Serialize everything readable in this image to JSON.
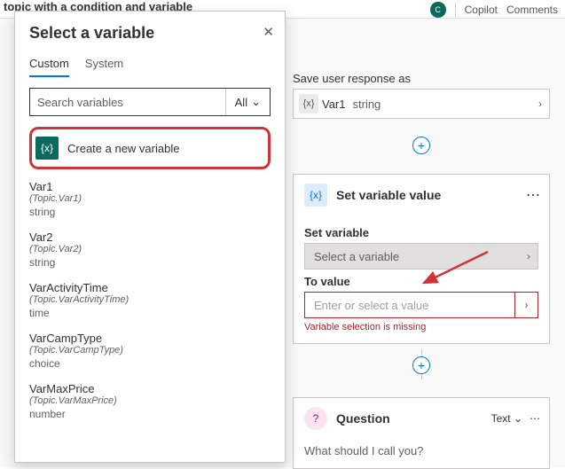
{
  "topbar": {
    "title_fragment": "topic with a condition and variable",
    "copilot": "Copilot",
    "comments": "Comments"
  },
  "flow": {
    "save_label": "Save user response as",
    "saved_var": {
      "name": "Var1",
      "type": "string"
    },
    "set_node": {
      "title": "Set variable value",
      "set_label": "Set variable",
      "select_placeholder": "Select a variable",
      "to_label": "To value",
      "to_placeholder": "Enter or select a value",
      "error": "Variable selection is missing"
    },
    "question_node": {
      "title": "Question",
      "type_label": "Text",
      "prompt": "What should I call you?"
    }
  },
  "popover": {
    "title": "Select a variable",
    "tabs": {
      "custom": "Custom",
      "system": "System"
    },
    "search_placeholder": "Search variables",
    "filter_all": "All",
    "create_label": "Create a new variable",
    "vars": [
      {
        "name": "Var1",
        "topic": "(Topic.Var1)",
        "type": "string"
      },
      {
        "name": "Var2",
        "topic": "(Topic.Var2)",
        "type": "string"
      },
      {
        "name": "VarActivityTime",
        "topic": "(Topic.VarActivityTime)",
        "type": "time"
      },
      {
        "name": "VarCampType",
        "topic": "(Topic.VarCampType)",
        "type": "choice"
      },
      {
        "name": "VarMaxPrice",
        "topic": "(Topic.VarMaxPrice)",
        "type": "number"
      }
    ]
  }
}
